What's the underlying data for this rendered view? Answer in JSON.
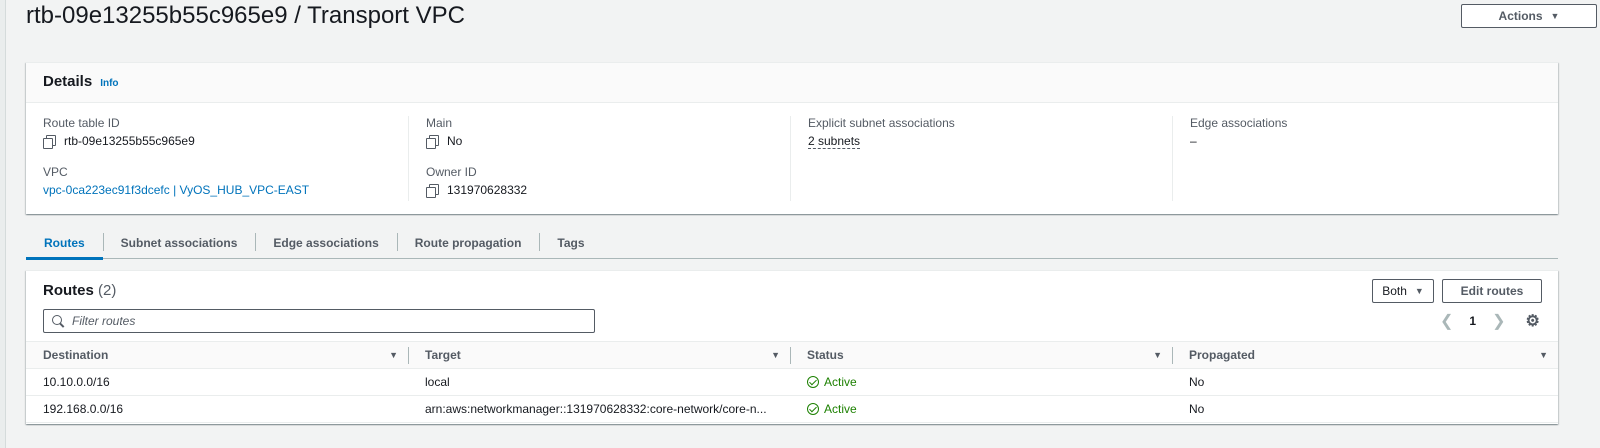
{
  "header": {
    "title": "rtb-09e13255b55c965e9 / Transport VPC",
    "actions_label": "Actions"
  },
  "details": {
    "title": "Details",
    "info_label": "Info",
    "route_table_id_label": "Route table ID",
    "route_table_id": "rtb-09e13255b55c965e9",
    "vpc_label": "VPC",
    "vpc_value": "vpc-0ca223ec91f3dcefc | VyOS_HUB_VPC-EAST",
    "main_label": "Main",
    "main_value": "No",
    "owner_id_label": "Owner ID",
    "owner_id": "131970628332",
    "explicit_label": "Explicit subnet associations",
    "explicit_value": "2 subnets",
    "edge_label": "Edge associations",
    "edge_value": "–"
  },
  "tabs": [
    {
      "label": "Routes",
      "active": true
    },
    {
      "label": "Subnet associations",
      "active": false
    },
    {
      "label": "Edge associations",
      "active": false
    },
    {
      "label": "Route propagation",
      "active": false
    },
    {
      "label": "Tags",
      "active": false
    }
  ],
  "routes": {
    "title": "Routes",
    "count": "(2)",
    "both_label": "Both",
    "edit_label": "Edit routes",
    "filter_placeholder": "Filter routes",
    "page": "1",
    "columns": [
      "Destination",
      "Target",
      "Status",
      "Propagated"
    ],
    "rows": [
      {
        "destination": "10.10.0.0/16",
        "target": "local",
        "status": "Active",
        "propagated": "No"
      },
      {
        "destination": "192.168.0.0/16",
        "target": "arn:aws:networkmanager::131970628332:core-network/core-n...",
        "status": "Active",
        "propagated": "No"
      }
    ]
  },
  "colors": {
    "accent": "#0073bb",
    "success": "#1d8102"
  }
}
